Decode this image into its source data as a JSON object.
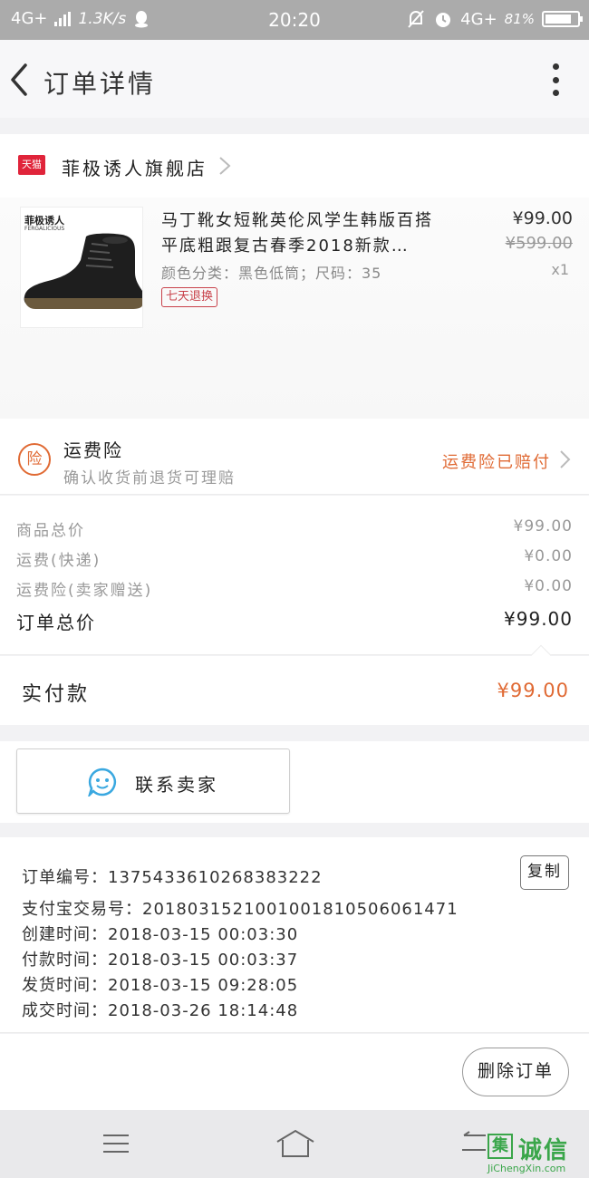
{
  "status_bar": {
    "network_left": "4G+",
    "speed": "1.3K/s",
    "time": "20:20",
    "network_right": "4G+",
    "battery": "81%",
    "battery_level": 0.81
  },
  "header": {
    "title": "订单详情",
    "back_icon": "chevron-left-icon",
    "more_icon": "more-vertical-icon"
  },
  "shop": {
    "badge": "天猫",
    "name": "菲极诱人旗舰店"
  },
  "product": {
    "brand": "菲极诱人",
    "brand_sub": "FERGALICIOUS",
    "title": "马丁靴女短靴英伦风学生韩版百搭平底粗跟复古春季2018新款…",
    "spec": "颜色分类：黑色低筒；尺码：35",
    "tag": "七天退换",
    "price": "¥99.00",
    "original_price": "¥599.00",
    "quantity": "x1"
  },
  "insurance": {
    "icon_label": "险",
    "title": "运费险",
    "desc": "确认收货前退货可理赔",
    "status": "运费险已赔付"
  },
  "costs": [
    {
      "label": "商品总价",
      "value": "¥99.00"
    },
    {
      "label": "运费(快递)",
      "value": "¥0.00"
    },
    {
      "label": "运费险(卖家赠送)",
      "value": "¥0.00"
    },
    {
      "label": "订单总价",
      "value": "¥99.00"
    }
  ],
  "payment": {
    "label": "实付款",
    "value": "¥99.00"
  },
  "contact": {
    "label": "联系卖家"
  },
  "order_info": {
    "order_no": "订单编号：1375433610268383222",
    "alipay_no": "支付宝交易号：2018031521001001810506061471",
    "created": "创建时间：2018-03-15  00:03:30",
    "paid": "付款时间：2018-03-15  00:03:37",
    "shipped": "发货时间：2018-03-15  09:28:05",
    "completed": "成交时间：2018-03-26  18:14:48",
    "copy_label": "复制"
  },
  "actions": {
    "delete_label": "删除订单"
  },
  "watermark": {
    "box": "集",
    "text": "诚信",
    "url": "JiChengXin.com"
  },
  "colors": {
    "accent": "#e06a34",
    "tmall_red": "#e0243a",
    "tag_red": "#c8414a"
  }
}
